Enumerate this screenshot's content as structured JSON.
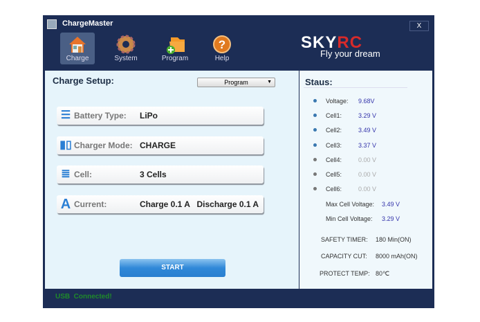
{
  "window": {
    "title": "ChargeMaster",
    "close_label": "X"
  },
  "nav": [
    {
      "label": "Charge",
      "icon": "house-icon",
      "active": true
    },
    {
      "label": "System",
      "icon": "gear-icon"
    },
    {
      "label": "Program",
      "icon": "folder-add-icon"
    },
    {
      "label": "Help",
      "icon": "help-icon"
    }
  ],
  "logo": {
    "sky": "SKY",
    "rc": "RC",
    "tagline": "Fly your dream"
  },
  "setup": {
    "title": "Charge Setup:",
    "program_select": "Program",
    "rows": [
      {
        "label": "Battery Type:",
        "value": "LiPo",
        "icon": "list-icon"
      },
      {
        "label": "Charger Mode:",
        "value": "CHARGE",
        "icon": "battery-mode-icon"
      },
      {
        "label": "Cell:",
        "value": "3 Cells",
        "icon": "cells-icon"
      },
      {
        "label": "Current:",
        "value": "Charge 0.1 A   Discharge 0.1 A",
        "icon": "current-icon"
      }
    ],
    "start_label": "START"
  },
  "status": {
    "title": "Staus:",
    "items": [
      {
        "label": "Voltage:",
        "value": "9.68V",
        "active": true
      },
      {
        "label": "Cell1:",
        "value": "3.29 V",
        "active": true
      },
      {
        "label": "Cell2:",
        "value": "3.49 V",
        "active": true
      },
      {
        "label": "Cell3:",
        "value": "3.37 V",
        "active": true
      },
      {
        "label": "Cell4:",
        "value": "0.00 V",
        "active": false
      },
      {
        "label": "Cell5:",
        "value": "0.00 V",
        "active": false
      },
      {
        "label": "Cell6:",
        "value": "0.00 V",
        "active": false
      }
    ],
    "max_cell": {
      "label": "Max Cell Voltage:",
      "value": "3.49 V"
    },
    "min_cell": {
      "label": "Min Cell Voltage:",
      "value": "3.29 V"
    },
    "safety_timer": {
      "label": "SAFETY TIMER:",
      "value": "180 Min(ON)"
    },
    "capacity_cut": {
      "label": "CAPACITY CUT:",
      "value": "8000 mAh(ON)"
    },
    "protect_temp": {
      "label": "PROTECT TEMP:",
      "value": "80℃"
    }
  },
  "footer": {
    "usb_status": "USB  Connected!"
  },
  "colors": {
    "header": "#1c2d55",
    "accent": "#2b7fd4",
    "active_dot": "#3a78b0",
    "inactive_dot": "#777777",
    "usb_green": "#1f8a2a",
    "logo_red": "#d72a2a"
  }
}
